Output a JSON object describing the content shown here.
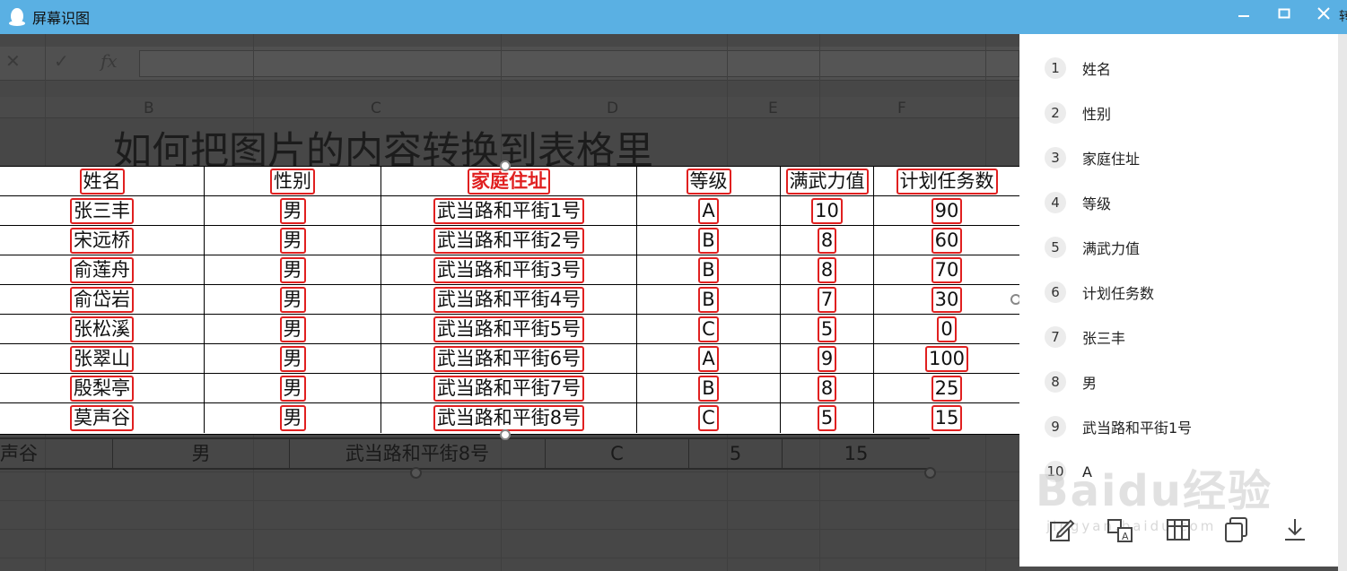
{
  "window": {
    "title": "屏幕识图",
    "edge_text": "转"
  },
  "sheet": {
    "columns": [
      "B",
      "C",
      "D",
      "E",
      "F"
    ],
    "title": "如何把图片的内容转换到表格里",
    "bottom_row": [
      "声谷",
      "男",
      "武当路和平街8号",
      "C",
      "5",
      "15"
    ]
  },
  "table": {
    "headers": [
      "姓名",
      "性别",
      "家庭住址",
      "等级",
      "满武力值",
      "计划任务数"
    ],
    "rows": [
      [
        "张三丰",
        "男",
        "武当路和平街1号",
        "A",
        "10",
        "90"
      ],
      [
        "宋远桥",
        "男",
        "武当路和平街2号",
        "B",
        "8",
        "60"
      ],
      [
        "俞莲舟",
        "男",
        "武当路和平街3号",
        "B",
        "8",
        "70"
      ],
      [
        "俞岱岩",
        "男",
        "武当路和平街4号",
        "B",
        "7",
        "30"
      ],
      [
        "张松溪",
        "男",
        "武当路和平街5号",
        "C",
        "5",
        "0"
      ],
      [
        "张翠山",
        "男",
        "武当路和平街6号",
        "A",
        "9",
        "100"
      ],
      [
        "殷梨亭",
        "男",
        "武当路和平街7号",
        "B",
        "8",
        "25"
      ],
      [
        "莫声谷",
        "男",
        "武当路和平街8号",
        "C",
        "5",
        "15"
      ]
    ]
  },
  "panel": {
    "items": [
      {
        "num": "1",
        "text": "姓名"
      },
      {
        "num": "2",
        "text": "性别"
      },
      {
        "num": "3",
        "text": "家庭住址"
      },
      {
        "num": "4",
        "text": "等级"
      },
      {
        "num": "5",
        "text": "满武力值"
      },
      {
        "num": "6",
        "text": "计划任务数"
      },
      {
        "num": "7",
        "text": "张三丰"
      },
      {
        "num": "8",
        "text": "男"
      },
      {
        "num": "9",
        "text": "武当路和平街1号"
      },
      {
        "num": "10",
        "text": "A"
      }
    ],
    "tools": [
      "edit-icon",
      "translate-icon",
      "table-icon",
      "copy-icon",
      "download-icon"
    ],
    "watermark": "Baidu经验",
    "watermark_sub": "jingyan.baidu.com"
  },
  "colors": {
    "titlebar": "#5ab0e3",
    "highlight_box": "#e02020"
  }
}
